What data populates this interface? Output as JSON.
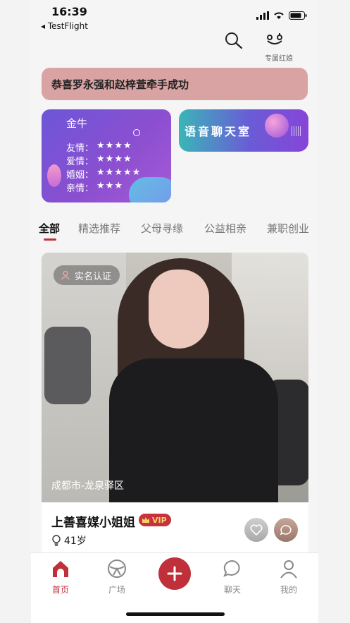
{
  "status_bar": {
    "time": "16:39",
    "back_app": "◂ TestFlight"
  },
  "top_actions": {
    "matchmaker_label": "专属红娘"
  },
  "banner": {
    "text": "恭喜罗永强和赵梓萱牵手成功"
  },
  "horoscope": {
    "sign": "金牛",
    "rows": [
      {
        "label": "友情：",
        "stars": "★★★★"
      },
      {
        "label": "爱情：",
        "stars": "★★★★"
      },
      {
        "label": "婚姻：",
        "stars": "★★★★★"
      },
      {
        "label": "亲情：",
        "stars": "★★★"
      }
    ]
  },
  "voice_room": {
    "title": "语音聊天室"
  },
  "tabs": [
    {
      "label": "全部",
      "active": true
    },
    {
      "label": "精选推荐"
    },
    {
      "label": "父母寻缘"
    },
    {
      "label": "公益相亲"
    },
    {
      "label": "兼职创业"
    }
  ],
  "profile": {
    "verified_label": "实名认证",
    "location": "成都市-龙泉驿区",
    "name": "上善喜媒小姐姐",
    "vip_label": "VIP",
    "age": "41岁"
  },
  "tabbar": [
    {
      "label": "首页",
      "icon": "home-icon",
      "active": true
    },
    {
      "label": "广场",
      "icon": "plaza-icon"
    },
    {
      "label": "",
      "icon": "plus-icon"
    },
    {
      "label": "聊天",
      "icon": "chat-icon"
    },
    {
      "label": "我的",
      "icon": "user-icon"
    }
  ],
  "colors": {
    "accent": "#c0303a",
    "banner_bg": "#d9a3a3"
  }
}
